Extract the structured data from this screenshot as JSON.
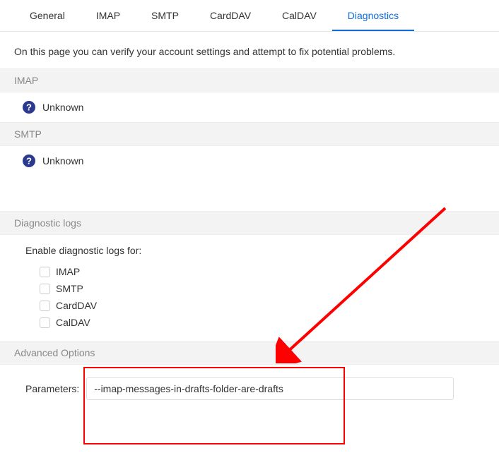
{
  "tabs": {
    "general": "General",
    "imap": "IMAP",
    "smtp": "SMTP",
    "carddav": "CardDAV",
    "caldav": "CalDAV",
    "diagnostics": "Diagnostics"
  },
  "intro": "On this page you can verify your account settings and attempt to fix potential problems.",
  "sections": {
    "imap": {
      "header": "IMAP",
      "status": "Unknown"
    },
    "smtp": {
      "header": "SMTP",
      "status": "Unknown"
    },
    "logs": {
      "header": "Diagnostic logs",
      "enable_label": "Enable diagnostic logs for:",
      "options": {
        "imap": "IMAP",
        "smtp": "SMTP",
        "carddav": "CardDAV",
        "caldav": "CalDAV"
      }
    },
    "advanced": {
      "header": "Advanced Options",
      "param_label": "Parameters:",
      "param_value": "--imap-messages-in-drafts-folder-are-drafts"
    }
  }
}
